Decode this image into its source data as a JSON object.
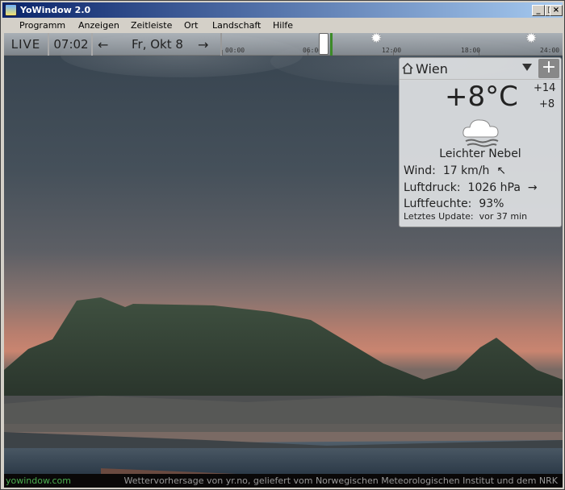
{
  "window": {
    "title": "YoWindow 2.0",
    "min_label": "_",
    "max_label": "□",
    "close_label": "×"
  },
  "menu": [
    "Programm",
    "Anzeigen",
    "Zeitleiste",
    "Ort",
    "Landschaft",
    "Hilfe"
  ],
  "topbar": {
    "live": "LIVE",
    "time": "07:02",
    "back_arrow": "←",
    "date": "Fr, Okt 8",
    "forward_arrow": "→",
    "timeline_ticks": [
      "00:00",
      "06:00",
      "12:00",
      "18:00",
      "24:00"
    ],
    "current_position_fraction": 0.29
  },
  "weather": {
    "city": "Wien",
    "add_label": "+",
    "temperature": "+8°C",
    "temp_high": "+14",
    "temp_low": "+8",
    "condition": "Leichter Nebel",
    "condition_icon": "fog-cloud-icon",
    "wind_label": "Wind:",
    "wind_value": "17 km/h",
    "wind_dir": "↖",
    "pressure_label": "Luftdruck:",
    "pressure_value": "1026 hPa",
    "pressure_trend": "→",
    "humidity_label": "Luftfeuchte:",
    "humidity_value": "93%",
    "update_label": "Letztes Update:",
    "update_value": "vor 37 min"
  },
  "footer": {
    "site": "yowindow.com",
    "credit": "Wettervorhersage von yr.no, geliefert vom Norwegischen Meteorologischen Institut und dem NRK"
  },
  "colors": {
    "title_start": "#0a246a",
    "title_end": "#a6caf0",
    "site_link": "#4caf50",
    "timeline_cursor": "#3c8a28"
  }
}
